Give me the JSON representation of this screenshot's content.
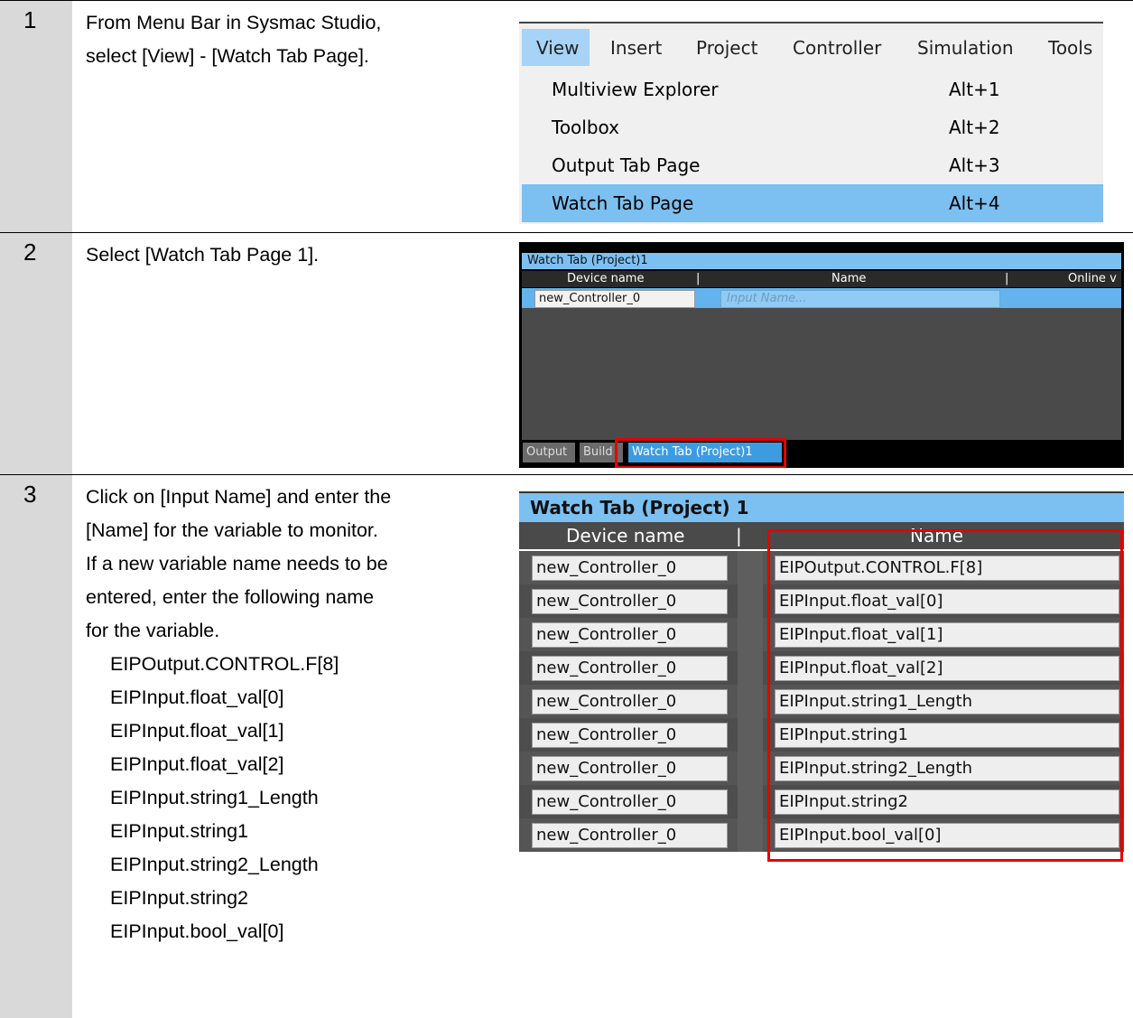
{
  "steps": [
    {
      "number": "1",
      "lines": [
        "From Menu Bar in Sysmac Studio,",
        "select [View] - [Watch Tab Page]."
      ]
    },
    {
      "number": "2",
      "lines": [
        "Select [Watch Tab Page 1]."
      ]
    },
    {
      "number": "3",
      "lines": [
        "Click on [Input Name] and enter the",
        "[Name] for the variable to monitor.",
        "If a new variable name needs to be",
        "entered, enter the following name",
        "for the variable."
      ],
      "variables": [
        "EIPOutput.CONTROL.F[8]",
        "EIPInput.float_val[0]",
        "EIPInput.float_val[1]",
        "EIPInput.float_val[2]",
        "EIPInput.string1_Length",
        "EIPInput.string1",
        "EIPInput.string2_Length",
        "EIPInput.string2",
        "EIPInput.bool_val[0]"
      ]
    }
  ],
  "menu": {
    "bar": [
      "View",
      "Insert",
      "Project",
      "Controller",
      "Simulation",
      "Tools"
    ],
    "items": [
      {
        "label": "Multiview Explorer",
        "shortcut": "Alt+1"
      },
      {
        "label": "Toolbox",
        "shortcut": "Alt+2"
      },
      {
        "label": "Output Tab Page",
        "shortcut": "Alt+3"
      },
      {
        "label": "Watch Tab Page",
        "shortcut": "Alt+4"
      }
    ],
    "selected_item": "Watch Tab Page"
  },
  "watch_small": {
    "title": "Watch Tab (Project)1",
    "columns": [
      "Device name",
      "Name",
      "Online v"
    ],
    "device": "new_Controller_0",
    "input_placeholder": "Input Name...",
    "tabs": [
      "Output",
      "Build",
      "Watch Tab (Project)1"
    ],
    "active_tab": "Watch Tab (Project)1"
  },
  "watch_large": {
    "title": "Watch Tab (Project) 1",
    "columns": [
      "Device name",
      "Name"
    ],
    "rows": [
      {
        "device": "new_Controller_0",
        "name": "EIPOutput.CONTROL.F[8]"
      },
      {
        "device": "new_Controller_0",
        "name": "EIPInput.float_val[0]"
      },
      {
        "device": "new_Controller_0",
        "name": "EIPInput.float_val[1]"
      },
      {
        "device": "new_Controller_0",
        "name": "EIPInput.float_val[2]"
      },
      {
        "device": "new_Controller_0",
        "name": "EIPInput.string1_Length"
      },
      {
        "device": "new_Controller_0",
        "name": "EIPInput.string1"
      },
      {
        "device": "new_Controller_0",
        "name": "EIPInput.string2_Length"
      },
      {
        "device": "new_Controller_0",
        "name": "EIPInput.string2"
      },
      {
        "device": "new_Controller_0",
        "name": "EIPInput.bool_val[0]"
      }
    ]
  },
  "colors": {
    "highlight": "#e60000",
    "menu_selected": "#7cc0f2",
    "step_column": "#d9d9d9"
  }
}
